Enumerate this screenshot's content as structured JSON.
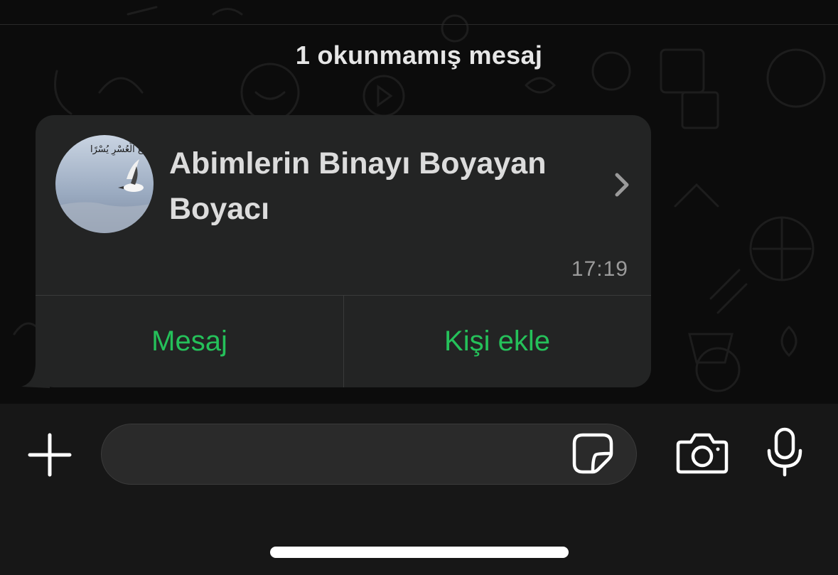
{
  "chat": {
    "unread_banner": "1 okunmamış mesaj"
  },
  "contact_card": {
    "name": "Abimlerin Binayı Boyayan Boyacı",
    "avatar_text": "إِنَّ مَعَ الْعُسْرِ يُسْرًا",
    "time": "17:19",
    "message_button": "Mesaj",
    "add_contact_button": "Kişi ekle"
  },
  "composer": {
    "input_value": "",
    "input_placeholder": ""
  },
  "icons": {
    "plus": "plus-icon",
    "sticker": "sticker-icon",
    "camera": "camera-icon",
    "mic": "microphone-icon",
    "chevron": "chevron-right-icon"
  },
  "colors": {
    "accent": "#25c15a",
    "card": "#232424",
    "background": "#0c0c0c"
  }
}
